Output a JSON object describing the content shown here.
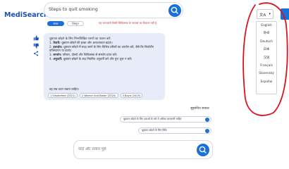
{
  "header": {
    "brand": "MediSearch",
    "search_value": "Steps to quit smoking",
    "search_button_icon": "search-icon"
  },
  "toolbar": {
    "mode_active": "सरल",
    "mode_inactive": "विस्तृत",
    "disclaimer": "यह जानकारी किसी चिकित्सक के परामर्श का विकल्प नहीं है"
  },
  "side_actions": {
    "icons": [
      "thumbs-up-icon",
      "thumbs-down-icon",
      "share-icon"
    ]
  },
  "answer": {
    "intro": "धूम्रपान छोड़ने के लिए निम्नलिखित चरणों का पालन करें:",
    "items": [
      {
        "num": "1.",
        "title": "तैयारी:",
        "text": "धूम्रपान छोड़ने की इच्छा और आवश्यकता बढ़ाएं।"
      },
      {
        "num": "2.",
        "title": "हस्तक्षेप:",
        "text": "धूम्रपान छोड़ने में मदद करने के लिए विभिन्न तरीकों का उपयोग करें, जैसे कि निकोटीन प्रतिस्थापन या दवाएं।"
      },
      {
        "num": "3.",
        "title": "समर्थन:",
        "text": "परिवार, दोस्तों और चिकित्सक से समर्थन प्राप्त करें।"
      },
      {
        "num": "4.",
        "title": "अनुवर्ती:",
        "text": "धूम्रपान छोड़ने के बाद नियमित अनुवर्ती करें और पुनः शुरू न करें।"
      }
    ],
    "outro": "यह सब ध्यान रखना चाहिए।",
    "sources": [
      "1 Smokefree (2021)",
      "2 Warner and Baker (2020)",
      "3 Boyd (2019)"
    ]
  },
  "related": {
    "title": "सुझावित सवाल",
    "questions": [
      "धूम्रपान छोड़ने के लिए दवाओं के बारे में अधिक जानकारी चाहिए",
      "धूम्रपान छोड़ने के लिए विधि"
    ]
  },
  "followup": {
    "placeholder": "कोई और सवाल पूछें"
  },
  "language": {
    "current": "文A",
    "options": [
      "English",
      "हिन्दी",
      "Deutsch",
      "日本",
      "汉语",
      "Français",
      "Slovenský",
      "Español"
    ]
  },
  "colors": {
    "accent": "#1a6fd8",
    "brand": "#1a4fb5",
    "card_bg": "#e7ecf8",
    "disclaimer": "#c23a2f",
    "annotation": "#d9141e"
  }
}
